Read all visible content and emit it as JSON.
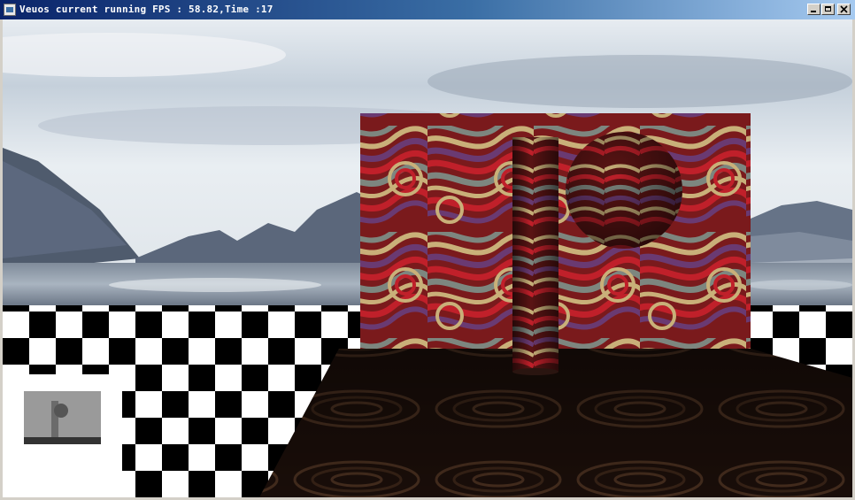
{
  "window": {
    "title": "Veuos current running FPS : 58.82,Time :17"
  },
  "titlebar_controls": {
    "minimize_icon": "minimize-icon",
    "maximize_icon": "maximize-icon",
    "close_icon": "close-icon"
  },
  "scene": {
    "description_icons": [
      "sky",
      "mountains",
      "lake",
      "checkerboard-floor",
      "patterned-wall",
      "patterned-cylinder",
      "patterned-sphere",
      "shadow-map-preview"
    ],
    "colors": {
      "sky_top": "#c9d3dd",
      "water": "#9aa6b5",
      "pattern_red": "#c0202a",
      "pattern_gold": "#c9b079",
      "pattern_purple": "#6a3a72",
      "pattern_gray": "#7d867f",
      "floor_dark": "#1c0f0a"
    }
  }
}
